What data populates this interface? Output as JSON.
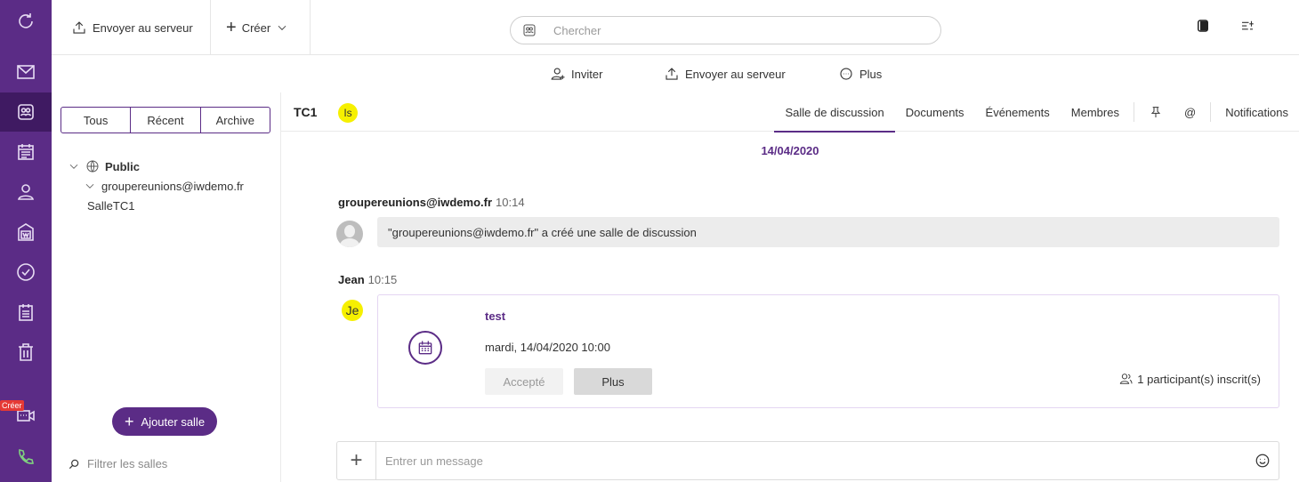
{
  "rail": {
    "items": [
      {
        "icon": "sync-icon"
      },
      {
        "icon": "mail-icon"
      },
      {
        "icon": "chat-rooms-icon"
      },
      {
        "icon": "calendar-icon"
      },
      {
        "icon": "contacts-icon"
      },
      {
        "icon": "documents-icon"
      },
      {
        "icon": "tasks-icon"
      },
      {
        "icon": "notes-icon"
      },
      {
        "icon": "trash-icon"
      },
      {
        "icon": "video-meeting-icon"
      },
      {
        "icon": "phone-icon"
      }
    ],
    "meeting_badge": "Créer"
  },
  "toolbar": {
    "upload_label": "Envoyer au serveur",
    "create_label": "Créer",
    "search_placeholder": "Chercher"
  },
  "subbar": {
    "invite_label": "Inviter",
    "upload_label": "Envoyer au serveur",
    "more_label": "Plus"
  },
  "leftpanel": {
    "segments": [
      "Tous",
      "Récent",
      "Archive"
    ],
    "tree": {
      "public_label": "Public",
      "group_label": "groupereunions@iwdemo.fr",
      "room_label": "SalleTC1"
    },
    "add_room_label": "Ajouter salle",
    "filter_placeholder": "Filtrer les salles"
  },
  "main": {
    "room_title": "TC1",
    "room_avatar": "Is",
    "tabs": [
      "Salle de discussion",
      "Documents",
      "Événements",
      "Membres"
    ],
    "notifications_label": "Notifications",
    "mention_label": "@",
    "date": "14/04/2020",
    "messages": [
      {
        "sender": "groupereunions@iwdemo.fr",
        "time": "10:14",
        "text": "\"groupereunions@iwdemo.fr\" a créé une salle de discussion"
      },
      {
        "sender": "Jean",
        "time": "10:15",
        "avatar": "Je"
      }
    ],
    "event": {
      "title": "test",
      "datetime": "mardi, 14/04/2020 10:00",
      "accept_label": "Accepté",
      "more_label": "Plus",
      "participants": "1 participant(s) inscrit(s)"
    },
    "composer_placeholder": "Entrer un message"
  },
  "colors": {
    "accent": "#5b2c86",
    "avatar_yellow": "#f6f000"
  }
}
